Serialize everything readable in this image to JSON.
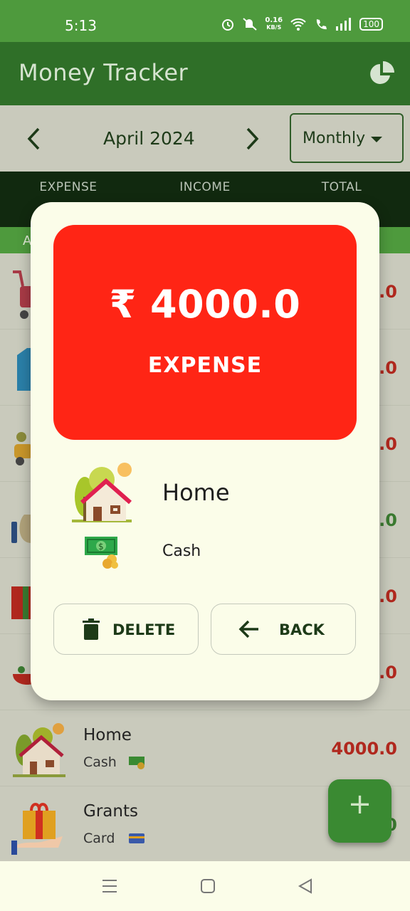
{
  "status_bar": {
    "time": "5:13",
    "net_speed_value": "0.16",
    "net_speed_unit": "KB/S",
    "battery": "100"
  },
  "app_bar": {
    "title": "Money Tracker"
  },
  "period": {
    "label": "April 2024",
    "mode": "Monthly"
  },
  "summary": {
    "expense_label": "EXPENSE",
    "income_label": "INCOME",
    "total_label": "TOTAL"
  },
  "section": {
    "label": "A"
  },
  "list": [
    {
      "amount": "0.0",
      "amount_color": "#c4241a"
    },
    {
      "amount": "0.0",
      "amount_color": "#c4241a"
    },
    {
      "amount": "0.0",
      "amount_color": "#c4241a"
    },
    {
      "amount": "0.0",
      "amount_color": "#3e8a32"
    },
    {
      "amount": "0.0",
      "amount_color": "#c4241a"
    },
    {
      "amount": "0.0",
      "amount_color": "#c4241a"
    },
    {
      "category": "Home",
      "account": "Cash",
      "amount": "4000.0",
      "amount_color": "#c4241a"
    },
    {
      "category": "Grants",
      "account": "Card",
      "amount": "0",
      "amount_color": "#3e8a32"
    }
  ],
  "dialog": {
    "amount": "₹ 4000.0",
    "type": "EXPENSE",
    "category": "Home",
    "account": "Cash",
    "delete_label": "DELETE",
    "back_label": "BACK",
    "card_color": "#ff2515"
  },
  "fab": {
    "symbol": "+"
  }
}
